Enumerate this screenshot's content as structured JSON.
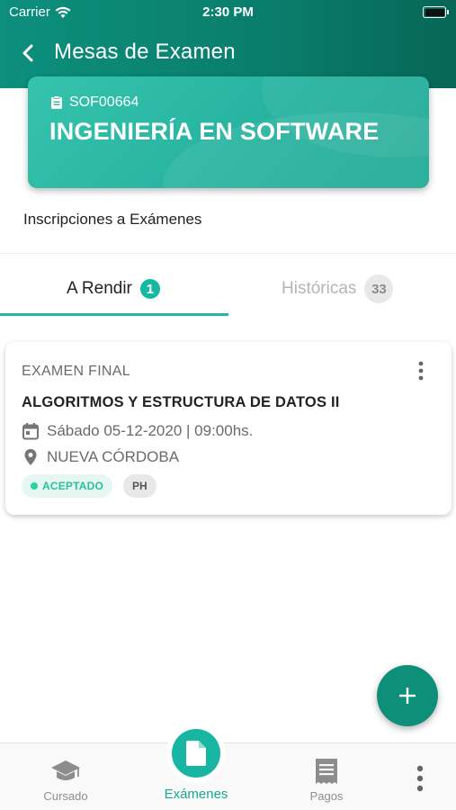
{
  "status_bar": {
    "carrier": "Carrier",
    "time": "2:30 PM"
  },
  "header": {
    "title": "Mesas de Examen"
  },
  "career": {
    "code": "SOF00664",
    "name": "INGENIERÍA EN SOFTWARE"
  },
  "section": {
    "label": "Inscripciones a Exámenes"
  },
  "tabs": [
    {
      "label": "A Rendir",
      "count": "1",
      "active": true
    },
    {
      "label": "Históricas",
      "count": "33",
      "active": false
    }
  ],
  "exam": {
    "type": "EXAMEN FINAL",
    "subject": "ALGORITMOS Y ESTRUCTURA DE DATOS II",
    "datetime": "Sábado 05-12-2020 | 09:00hs.",
    "location": "NUEVA CÓRDOBA",
    "status": "ACEPTADO",
    "user_tag": "PH"
  },
  "bottom_nav": {
    "cursado": "Cursado",
    "examenes": "Exámenes",
    "pagos": "Pagos"
  },
  "colors": {
    "primary": "#0d8f7d",
    "accent": "#18b6a2",
    "success": "#2bbf9a"
  },
  "icons": [
    "wifi-icon",
    "battery-icon",
    "back-arrow-icon",
    "clipboard-icon",
    "more-vert-icon",
    "calendar-icon",
    "location-pin-icon",
    "plus-icon",
    "graduation-cap-icon",
    "document-icon",
    "receipt-icon"
  ]
}
